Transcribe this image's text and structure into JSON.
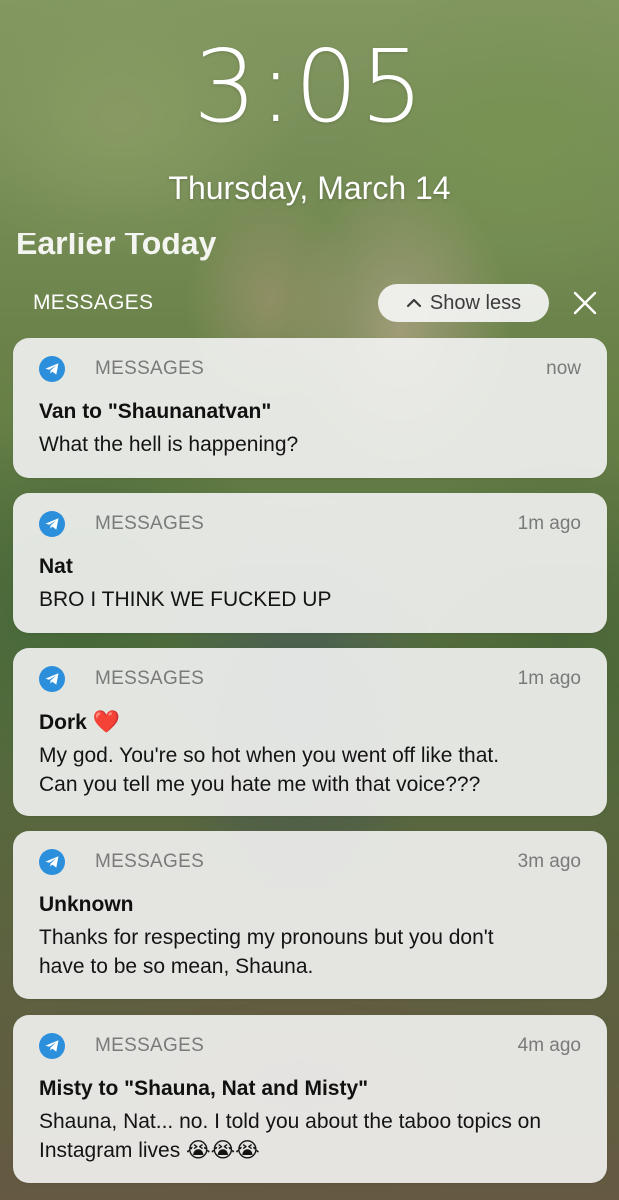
{
  "lockscreen": {
    "time": "3:05",
    "date": "Thursday, March 14",
    "earlier_header": "Earlier Today"
  },
  "group": {
    "title": "MESSAGES",
    "show_less_label": "Show less"
  },
  "notifications": [
    {
      "app": "MESSAGES",
      "time": "now",
      "sender": "Van to \"Shaunanatvan\"",
      "lines": [
        "What the hell is happening?"
      ]
    },
    {
      "app": "MESSAGES",
      "time": "1m ago",
      "sender": "Nat",
      "lines": [
        "BRO I THINK WE FUCKED UP"
      ]
    },
    {
      "app": "MESSAGES",
      "time": "1m ago",
      "sender": "Dork",
      "sender_emoji": "❤️",
      "lines": [
        "My god. You're so hot when you went off like that.",
        "Can you tell me you hate me with that voice???"
      ]
    },
    {
      "app": "MESSAGES",
      "time": "3m ago",
      "sender": "Unknown",
      "lines": [
        "Thanks for respecting my pronouns but you don't",
        "have to be so mean, Shauna."
      ]
    },
    {
      "app": "MESSAGES",
      "time": "4m ago",
      "sender": "Misty to \"Shauna, Nat and Misty\"",
      "lines": [
        "Shauna, Nat... no. I told you about the taboo topics on",
        "Instagram lives 😭😭😭"
      ]
    }
  ],
  "icons": {
    "app": "telegram-paper-plane-icon",
    "show_less": "chevron-up-icon",
    "close": "close-icon"
  },
  "colors": {
    "app_icon": "#2c8fdc",
    "card_bg": "#f3f3f3",
    "meta_text": "#7a7a7a"
  }
}
